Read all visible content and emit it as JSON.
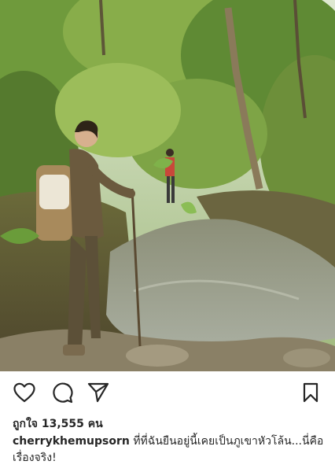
{
  "post": {
    "photo_alt": "woman with backpack standing by a forest stream",
    "likes_label": "ถูกใจ 13,555 คน",
    "username": "cherrykhemupsorn",
    "caption_text": " ที่ที่ฉันยืนอยู่นี้เคยเป็นภูเขาหัวโล้น...นี่คือเรื่องจริง!"
  },
  "icons": {
    "like": "heart-outline-icon",
    "comment": "speech-bubble-icon",
    "share": "paper-plane-icon",
    "save": "bookmark-icon"
  },
  "colors": {
    "text": "#262626",
    "background": "#ffffff"
  }
}
